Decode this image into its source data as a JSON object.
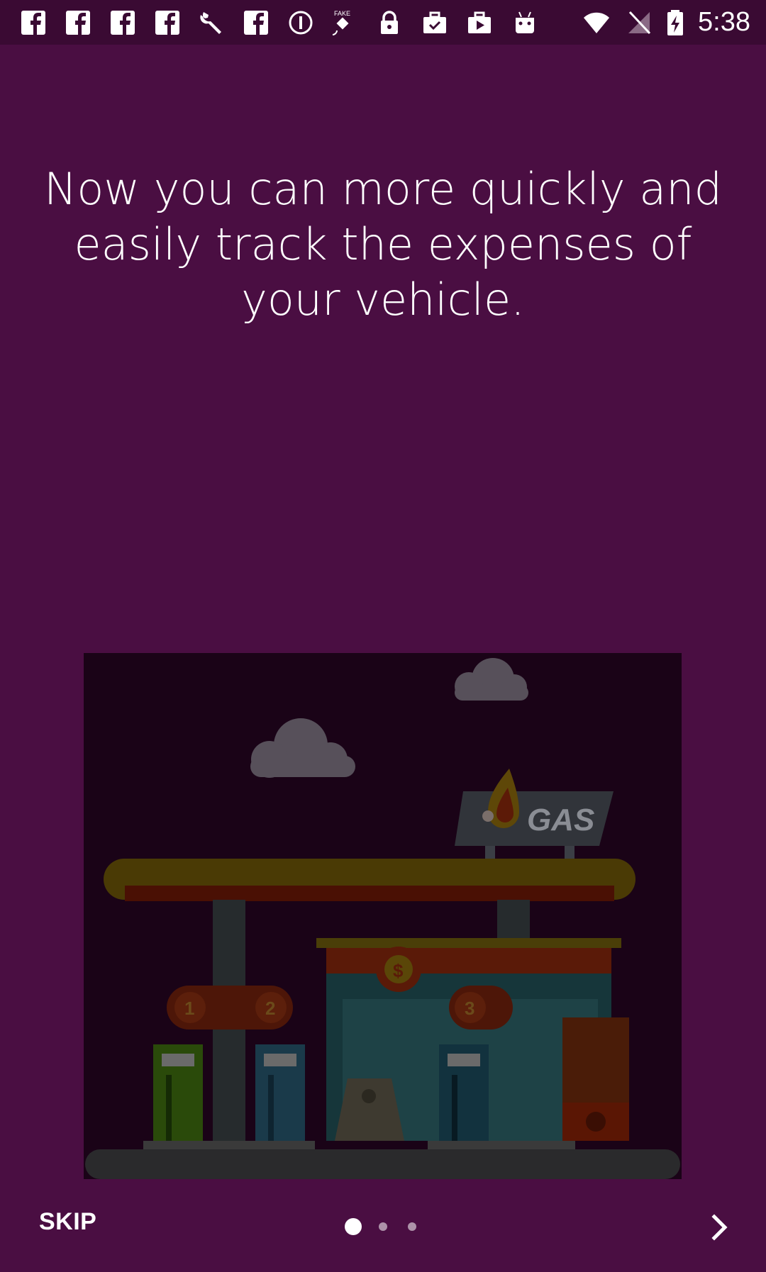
{
  "status_bar": {
    "time": "5:38",
    "icons": [
      "facebook-icon",
      "facebook-icon",
      "facebook-icon",
      "facebook-icon",
      "wrench-icon",
      "facebook-icon",
      "info-icon",
      "fake-gps-icon",
      "lock-icon",
      "briefcase-check-icon",
      "play-store-icon",
      "android-icon",
      "wifi-icon",
      "no-signal-icon",
      "battery-charging-icon"
    ]
  },
  "onboarding": {
    "headline": "Now you can more quickly and easily track the expenses of your vehicle.",
    "illustration": {
      "sign_text": "GAS",
      "pump_numbers": [
        "1",
        "2",
        "3"
      ],
      "price_symbol": "$"
    }
  },
  "navigation": {
    "skip_label": "SKIP",
    "page_count": 3,
    "current_page": 1
  },
  "colors": {
    "background": "#4a0e42",
    "status_bar": "#3a0a33",
    "illustration_bg": "#1a0317"
  }
}
